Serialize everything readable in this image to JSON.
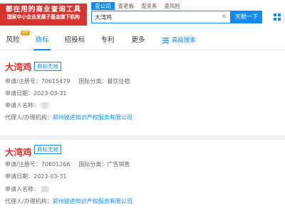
{
  "logo": {
    "line1": "都在用的商业查询工具",
    "line2": "国家中小企业发展子基金旗下机构"
  },
  "search": {
    "tabs": [
      "查公司",
      "查老板",
      "查关系",
      "查风险"
    ],
    "active_tab": 0,
    "value": "大湾鸡",
    "button_label": "天眼一下"
  },
  "nav": {
    "items": [
      {
        "label": "风险",
        "vip": "VIP"
      },
      {
        "label": "商标"
      },
      {
        "label": "招投标"
      },
      {
        "label": "专利"
      },
      {
        "label": "更多"
      }
    ],
    "active": 1,
    "advanced_search": "高级搜索"
  },
  "results": [
    {
      "name": "大湾鸡",
      "status": "商标无效",
      "reg_label": "申请/注册号：",
      "reg_no": "70615479",
      "class_label": "国际分类：",
      "class": "餐饮住宿",
      "date_label": "申请日期：",
      "date": "2023-03-31",
      "applicant_label": "申请人名称：",
      "agent_label": "代理人/办理机构：",
      "agent": "郑州锐进知识产权服务有限公司"
    },
    {
      "name": "大湾鸡",
      "status": "商标无效",
      "reg_label": "申请/注册号：",
      "reg_no": "70601266",
      "class_label": "国际分类：",
      "class": "广告销售",
      "date_label": "申请日期：",
      "date": "2023-03-31",
      "applicant_label": "申请人名称：",
      "agent_label": "代理人/办理机构：",
      "agent": "郑州锐进知识产权服务有限公司"
    }
  ],
  "colors": {
    "brand_blue": "#128bed",
    "brand_red": "#d83530",
    "vip_orange": "#f3a522"
  },
  "icons": [
    "close-icon",
    "grid-menu-icon",
    "filter-icon"
  ]
}
